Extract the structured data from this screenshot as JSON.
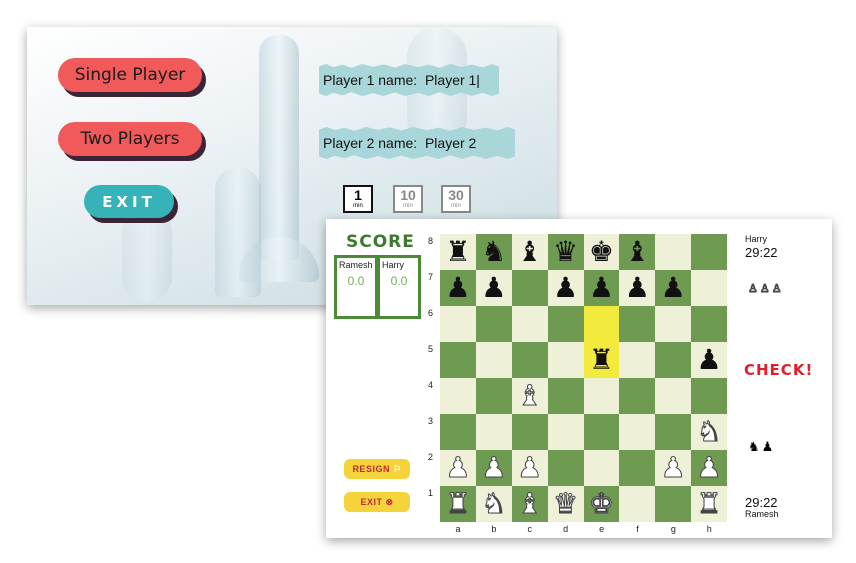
{
  "menu": {
    "single_player_label": "Single Player",
    "two_players_label": "Two Players",
    "exit_label": "EXIT",
    "player1_label": "Player 1 name:",
    "player1_value": "Player 1|",
    "player2_label": "Player 2 name:",
    "player2_value": "Player 2",
    "time_options": [
      {
        "value": "1",
        "unit": "min",
        "selected": true
      },
      {
        "value": "10",
        "unit": "min",
        "selected": false
      },
      {
        "value": "30",
        "unit": "min",
        "selected": false
      }
    ]
  },
  "game": {
    "score_title": "SCORE",
    "scores": [
      {
        "name": "Ramesh",
        "value": "0.0"
      },
      {
        "name": "Harry",
        "value": "0.0"
      }
    ],
    "resign_label": "RESIGN",
    "exit_label": "EXIT",
    "top_player": {
      "name": "Harry",
      "time": "29:22"
    },
    "bottom_player": {
      "name": "Ramesh",
      "time": "29:22"
    },
    "check_label": "CHECK!",
    "captured_white": "♙♙♙",
    "captured_black": "♞♟",
    "ranks": [
      "8",
      "7",
      "6",
      "5",
      "4",
      "3",
      "2",
      "1"
    ],
    "files": [
      "a",
      "b",
      "c",
      "d",
      "e",
      "f",
      "g",
      "h"
    ],
    "board": [
      [
        "br",
        "bn",
        "bb",
        "bq",
        "bk",
        "bb",
        "",
        ""
      ],
      [
        "bp",
        "bp",
        "",
        "bp",
        "bp",
        "bp",
        "bp",
        ""
      ],
      [
        "",
        "",
        "",
        "",
        "",
        "",
        "",
        ""
      ],
      [
        "",
        "",
        "",
        "",
        "br",
        "",
        "",
        "bp"
      ],
      [
        "",
        "",
        "wb",
        "",
        "",
        "",
        "",
        ""
      ],
      [
        "",
        "",
        "",
        "",
        "",
        "",
        "",
        "wn"
      ],
      [
        "wp",
        "wp",
        "wp",
        "",
        "",
        "",
        "wp",
        "wp"
      ],
      [
        "wr",
        "wn",
        "wb",
        "wq",
        "wk",
        "",
        "",
        "wr"
      ]
    ],
    "highlight": [
      "e6",
      "e5"
    ],
    "colors": {
      "light": "#eef1d8",
      "dark": "#6f9a52",
      "highlight": "#f2ea3c",
      "check": "#e01e2c"
    }
  }
}
